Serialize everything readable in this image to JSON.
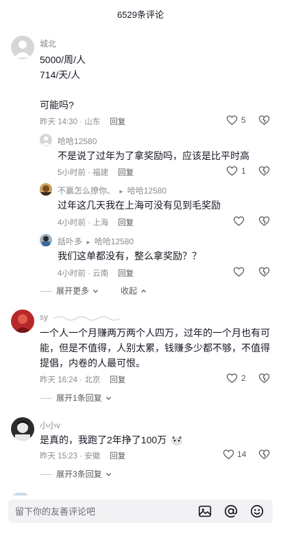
{
  "header": {
    "title": "6529条评论"
  },
  "comments": [
    {
      "user": "城北",
      "lines": [
        "5000/周/人",
        "714/天/人",
        "",
        "可能吗?"
      ],
      "time": "昨天 14:30 · 山东",
      "reply": "回复",
      "likes": "5",
      "replies": [
        {
          "user": "哈哈12580",
          "text": "不是说了过年为了拿奖励吗，应该是比平时高",
          "time": "5小时前 · 福建",
          "reply": "回复",
          "likes": "1"
        },
        {
          "user": "不赢怎么撩你、",
          "arrow": "▸",
          "target": "哈哈12580",
          "text": "过年这几天我在上海可没有见到毛奖励",
          "time": "4小时前 · 上海",
          "reply": "回复",
          "likes": ""
        },
        {
          "user": "話卟多",
          "arrow": "▸",
          "target": "哈哈12580",
          "text": "我们这单都没有，整么拿奖励？？",
          "time": "4小时前 · 云南",
          "reply": "回复",
          "likes": ""
        }
      ],
      "expand_more": "展开更多",
      "collapse": "收起"
    },
    {
      "user": "sy",
      "lines": [
        "一个人一个月赚两万两个人四万，过年的一个月也有可",
        "能，但是不值得，人别太累，钱赚多少都不够，不值得",
        "提倡，内卷的人最可恨。"
      ],
      "time": "昨天 16:24 · 北京",
      "reply": "回复",
      "likes": "2",
      "expand": "展开1条回复"
    },
    {
      "user": "小小v",
      "lines": [
        "是真的，我跑了2年挣了100万"
      ],
      "time": "昨天 15:23 · 安徽",
      "reply": "回复",
      "likes": "14",
      "expand": "展开3条回复"
    }
  ],
  "footer": {
    "placeholder": "留下你的友善评论吧"
  },
  "icons": [
    "heart-icon",
    "dislike-heart-icon",
    "chevron-down-icon",
    "chevron-up-icon",
    "image-icon",
    "at-icon",
    "emoji-icon"
  ]
}
